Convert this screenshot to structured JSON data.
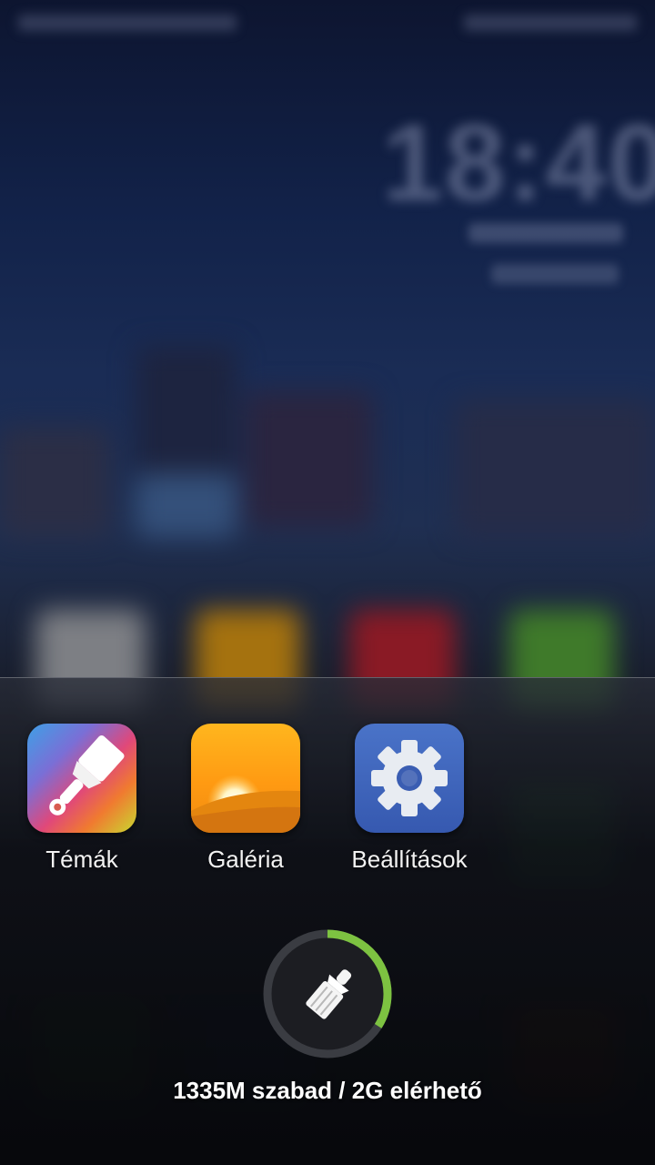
{
  "background": {
    "clock": "18:40"
  },
  "apps": [
    {
      "label": "Témák",
      "icon": "paint-brush-icon"
    },
    {
      "label": "Galéria",
      "icon": "sunset-icon"
    },
    {
      "label": "Beállítások",
      "icon": "gear-icon"
    }
  ],
  "cleaner": {
    "icon": "broom-icon",
    "usage_fraction": 0.34,
    "ring_color": "#7dc241",
    "track_color": "#3a3c42"
  },
  "memory": {
    "text": "1335M szabad / 2G elérhető"
  }
}
